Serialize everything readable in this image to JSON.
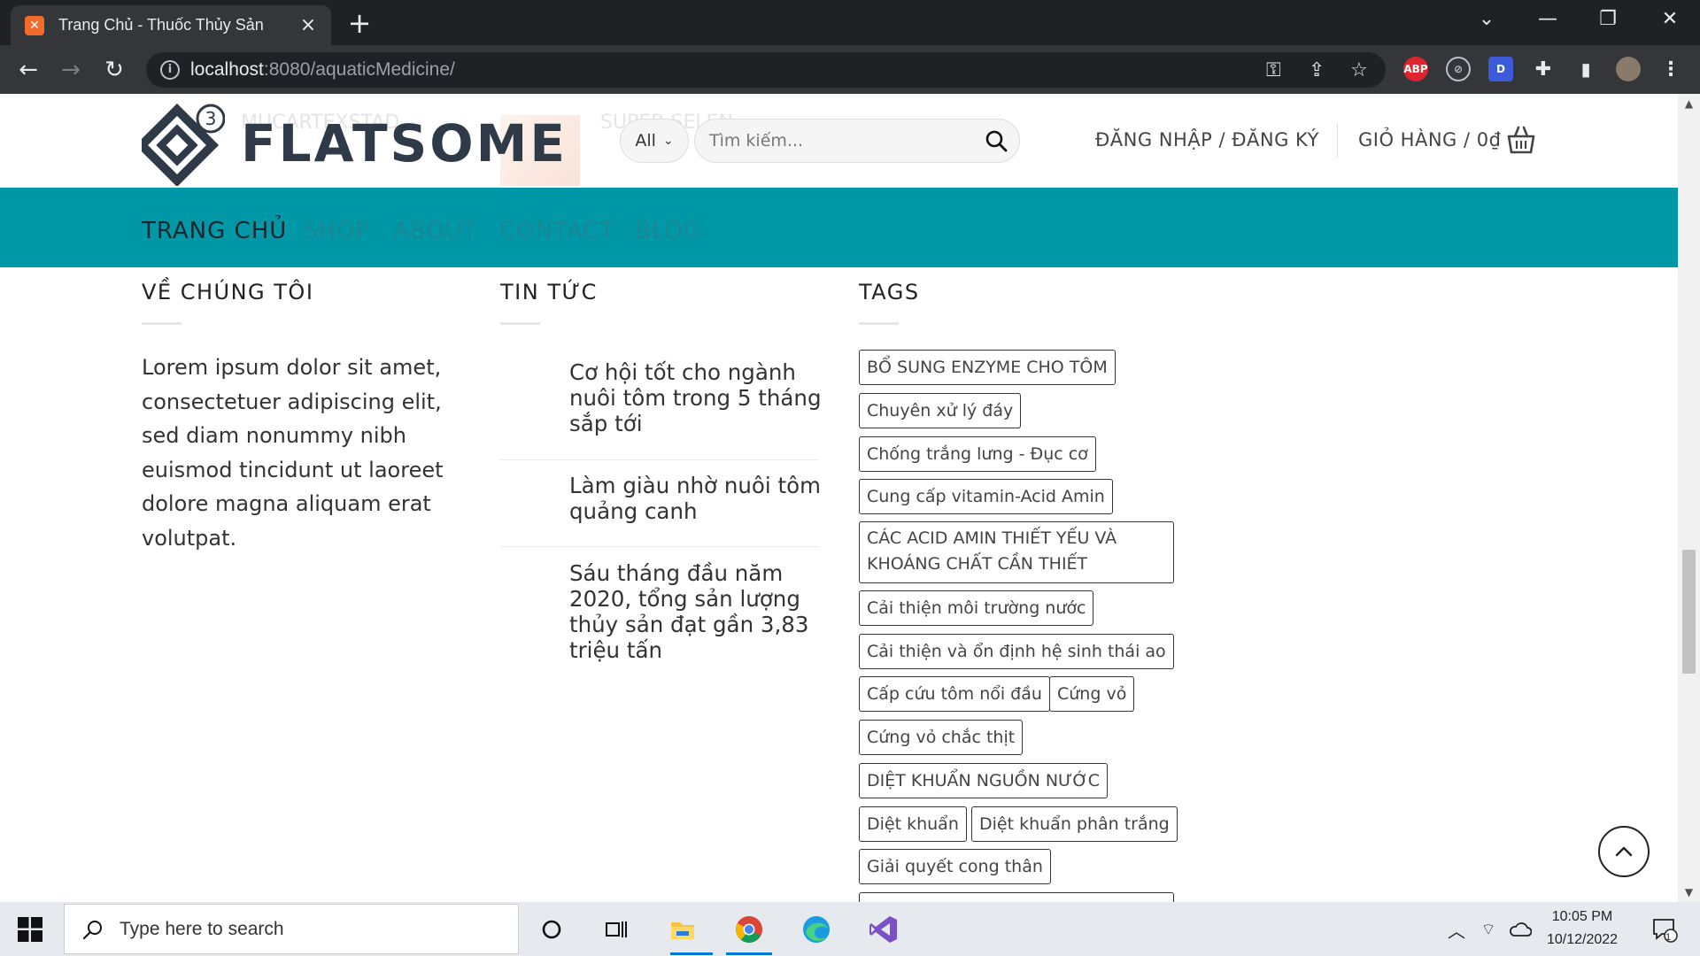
{
  "browser": {
    "tab_title": "Trang Chủ - Thuốc Thủy Sản",
    "url_host": "localhost",
    "url_rest": ":8080/aquaticMedicine/",
    "extensions": [
      "ABP",
      "D"
    ]
  },
  "header": {
    "logo_text": "FLATSOME",
    "logo_badge": "3",
    "ghost_label_1": "MUCARTEXSTAD",
    "ghost_label_2": "SUPER SELEN",
    "category_select": "All",
    "search_placeholder": "Tìm kiếm...",
    "account_link": "ĐĂNG NHẬP / ĐĂNG KÝ",
    "cart_link": "GIỎ HÀNG / 0₫"
  },
  "nav": {
    "items": [
      "TRANG CHỦ",
      "SHOP",
      "ABOUT",
      "CONTACT",
      "BLOG"
    ]
  },
  "about": {
    "title": "VỀ CHÚNG TÔI",
    "text": "Lorem ipsum dolor sit amet, consectetuer adipiscing elit, sed diam nonummy nibh euismod tincidunt ut laoreet dolore magna aliquam erat volutpat."
  },
  "news": {
    "title": "TIN TỨC",
    "items": [
      "Cơ hội tốt cho ngành nuôi tôm trong 5 tháng sắp tới",
      "Làm giàu nhờ nuôi tôm quảng canh",
      "Sáu tháng đầu năm 2020, tổng sản lượng thủy sản đạt gần 3,83 triệu tấn"
    ]
  },
  "tags": {
    "title": "TAGS",
    "items": [
      "BỔ SUNG ENZYME CHO TÔM",
      "Chuyên xử lý đáy",
      "Chống trắng lưng - Đục cơ",
      "Cung cấp vitamin-Acid Amin",
      "CÁC ACID AMIN THIẾT YẾU VÀ KHOÁNG CHẤT CẦN THIẾT",
      "Cải thiện môi trường nước",
      "Cải thiện và ổn định hệ sinh thái ao",
      "Cấp cứu tôm nổi đầu",
      "Cứng vỏ",
      "Cứng vỏ chắc thịt",
      "DIỆT KHUẨN NGUỒN NƯỚC",
      "Diệt khuẩn",
      "Diệt khuẩn phân trắng",
      "Giải quyết cong thân"
    ]
  },
  "taskbar": {
    "search_text": "Type here to search",
    "time": "10:05 PM",
    "date": "10/12/2022",
    "notification_count": "1"
  },
  "colors": {
    "nav_bg": "#0097a7",
    "chrome_dark": "#202124",
    "chrome_toolbar": "#35363a",
    "logo": "#2e3a48"
  }
}
